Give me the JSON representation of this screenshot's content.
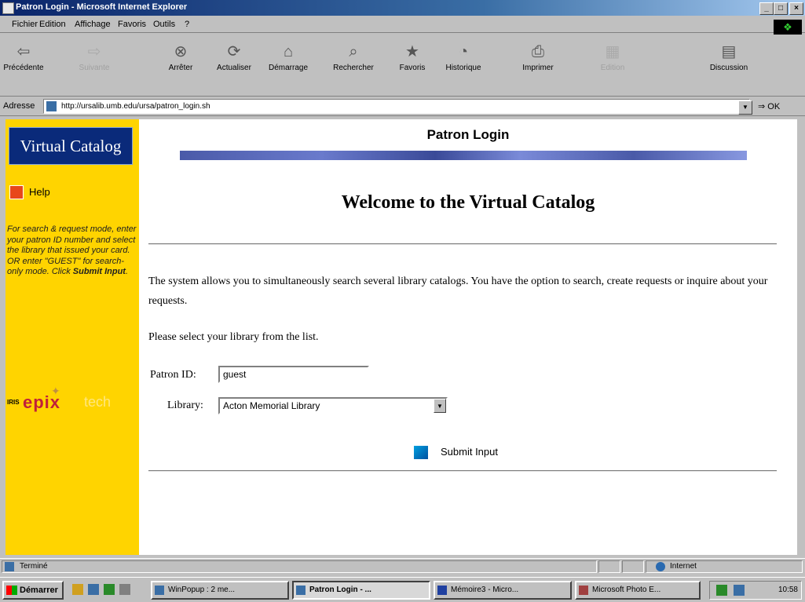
{
  "window": {
    "title": "Patron Login - Microsoft Internet Explorer",
    "buttons": [
      "_",
      "□",
      "×"
    ]
  },
  "menu": [
    "Fichier",
    "Edition",
    "Affichage",
    "Favoris",
    "Outils",
    "?"
  ],
  "toolbar": [
    {
      "label": "Précédente",
      "icon": "back-arrow-icon",
      "glyph": "⇦",
      "enabled": true
    },
    {
      "label": "Suivante",
      "icon": "forward-arrow-icon",
      "glyph": "⇨",
      "enabled": false
    },
    {
      "label": "Arrêter",
      "icon": "stop-icon",
      "glyph": "⊗",
      "enabled": true
    },
    {
      "label": "Actualiser",
      "icon": "refresh-icon",
      "glyph": "⟳",
      "enabled": true
    },
    {
      "label": "Démarrage",
      "icon": "home-icon",
      "glyph": "⌂",
      "enabled": true
    },
    {
      "label": "Rechercher",
      "icon": "search-icon",
      "glyph": "⌕",
      "enabled": true
    },
    {
      "label": "Favoris",
      "icon": "favorites-icon",
      "glyph": "★",
      "enabled": true
    },
    {
      "label": "Historique",
      "icon": "history-icon",
      "glyph": "◔",
      "enabled": true
    },
    {
      "label": "Imprimer",
      "icon": "print-icon",
      "glyph": "⎙",
      "enabled": true
    },
    {
      "label": "Edition",
      "icon": "edit-icon",
      "glyph": "▦",
      "enabled": false
    },
    {
      "label": "Discussion",
      "icon": "discuss-icon",
      "glyph": "▤",
      "enabled": true
    }
  ],
  "address": {
    "label": "Adresse",
    "url": "http://ursalib.umb.edu/ursa/patron_login.sh",
    "go": "OK"
  },
  "sidebar": {
    "logo": "Virtual Catalog",
    "help": "Help",
    "instructions_a": "For search & request mode, enter your patron ID number and select the library that issued your card. OR enter \"GUEST\" for search-only mode. Click",
    "instructions_b": "Submit Input",
    "partner_small": "IRIS",
    "partner_big": "epix"
  },
  "main": {
    "page_title": "Patron Login",
    "welcome": "Welcome to the Virtual Catalog",
    "intro": "The system allows you to simultaneously search several library catalogs. You have the option to search, create requests or inquire about your requests.",
    "select_prompt": "Please select your library from the list.",
    "patron_label": "Patron ID:",
    "patron_value": "guest",
    "library_label": "Library:",
    "library_value": "Acton Memorial Library",
    "submit": "Submit Input"
  },
  "status": {
    "left": "Terminé",
    "zone": "Internet"
  },
  "taskbar": {
    "start": "Démarrer",
    "tasks": [
      {
        "label": "WinPopup : 2 me...",
        "active": false
      },
      {
        "label": "Patron Login - ...",
        "active": true
      },
      {
        "label": "Mémoire3 - Micro...",
        "active": false
      },
      {
        "label": "Microsoft Photo E...",
        "active": false
      }
    ],
    "clock": "10:58"
  }
}
